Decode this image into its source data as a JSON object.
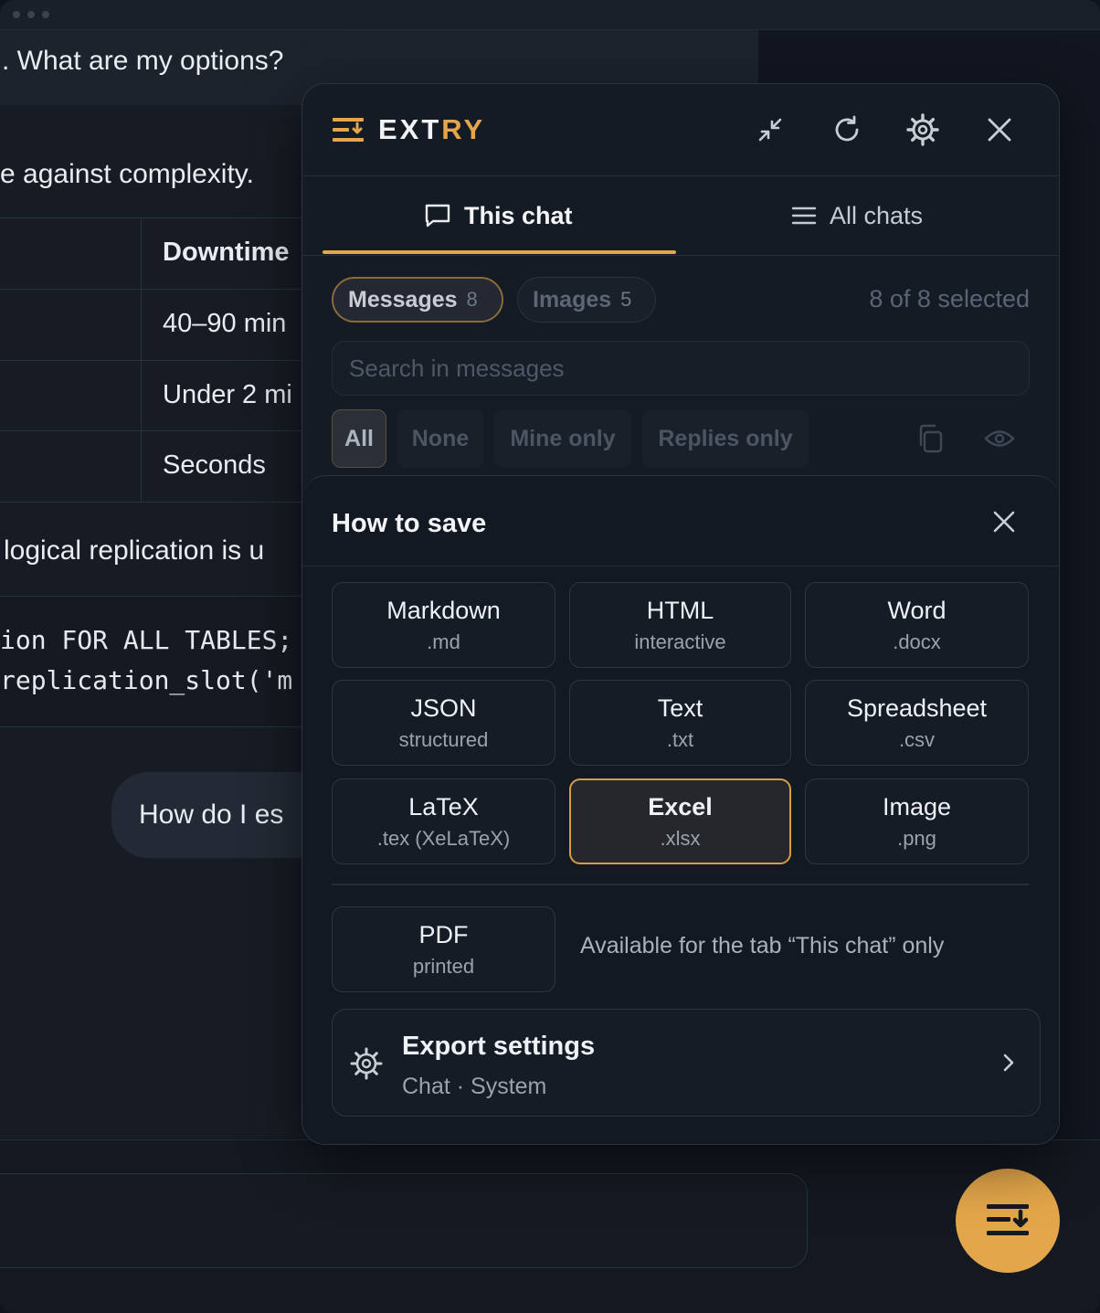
{
  "background_chat": {
    "line1": ". What are my options?",
    "line2": "e against complexity.",
    "table_header": "Downtime",
    "table_rows": [
      "40–90 min",
      "Under 2 mi",
      "Seconds"
    ],
    "line3": "logical replication is u",
    "code_line1": "ion FOR ALL TABLES;",
    "code_line2": "replication_slot('m",
    "user_message": "How do I es"
  },
  "panel": {
    "brand": {
      "name_part1": "EXT",
      "name_part2": "RY"
    },
    "header_icons": [
      "collapse-icon",
      "refresh-icon",
      "gear-icon",
      "close-icon"
    ],
    "tabs": [
      {
        "label": "This chat",
        "icon": "chat-bubble-icon",
        "active": true
      },
      {
        "label": "All chats",
        "icon": "list-icon",
        "active": false
      }
    ],
    "chips": [
      {
        "label": "Messages",
        "count": "8",
        "active": true
      },
      {
        "label": "Images",
        "count": "5",
        "active": false
      }
    ],
    "selected_text": "8 of 8 selected",
    "search_placeholder": "Search in messages",
    "filters": [
      {
        "label": "All",
        "active": true
      },
      {
        "label": "None",
        "active": false
      },
      {
        "label": "Mine only",
        "active": false
      },
      {
        "label": "Replies only",
        "active": false
      }
    ],
    "filter_icons": [
      "copy-icon",
      "eye-icon"
    ],
    "save_sheet": {
      "title": "How to save",
      "formats": [
        {
          "title": "Markdown",
          "sub": ".md",
          "selected": false
        },
        {
          "title": "HTML",
          "sub": "interactive",
          "selected": false
        },
        {
          "title": "Word",
          "sub": ".docx",
          "selected": false
        },
        {
          "title": "JSON",
          "sub": "structured",
          "selected": false
        },
        {
          "title": "Text",
          "sub": ".txt",
          "selected": false
        },
        {
          "title": "Spreadsheet",
          "sub": ".csv",
          "selected": false
        },
        {
          "title": "LaTeX",
          "sub": ".tex (XeLaTeX)",
          "selected": false
        },
        {
          "title": "Excel",
          "sub": ".xlsx",
          "selected": true
        },
        {
          "title": "Image",
          "sub": ".png",
          "selected": false
        }
      ],
      "pdf": {
        "title": "PDF",
        "sub": "printed"
      },
      "pdf_note": "Available for the tab “This chat” only",
      "export_settings": {
        "title": "Export settings",
        "sub": "Chat · System"
      }
    }
  },
  "colors": {
    "accent": "#e3a64a",
    "panel_bg": "#151b25",
    "page_bg": "#111620"
  }
}
